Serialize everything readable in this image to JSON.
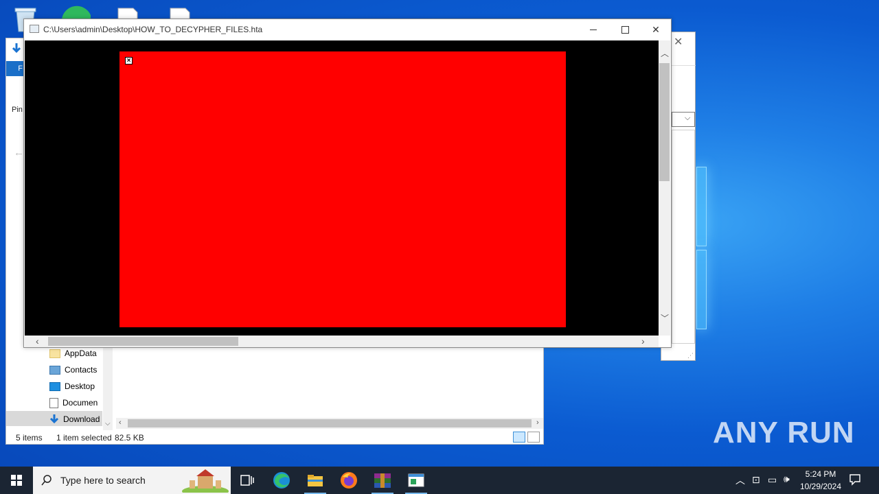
{
  "hta_window": {
    "title": "C:\\Users\\admin\\Desktop\\HOW_TO_DECYPHER_FILES.hta",
    "close_glyph": "×"
  },
  "explorer": {
    "ribbon_tab": "F",
    "pin_label": "Pin",
    "nav_items": [
      {
        "label": "AppData",
        "icon": "folder-icon"
      },
      {
        "label": "Contacts",
        "icon": "contacts-icon"
      },
      {
        "label": "Desktop",
        "icon": "desktop-folder-icon"
      },
      {
        "label": "Documen",
        "icon": "documents-icon"
      },
      {
        "label": "Download",
        "icon": "downloads-icon"
      }
    ],
    "status": {
      "items_count": "5 items",
      "selection": "1 item selected",
      "size": "82.5 KB"
    }
  },
  "taskbar": {
    "search_placeholder": "Type here to search",
    "time": "5:24 PM",
    "date": "10/29/2024",
    "pinned": [
      "task-view-icon",
      "edge-icon",
      "file-explorer-icon",
      "firefox-icon",
      "winrar-icon",
      "hta-app-icon"
    ]
  },
  "watermark": "ANY RUN"
}
